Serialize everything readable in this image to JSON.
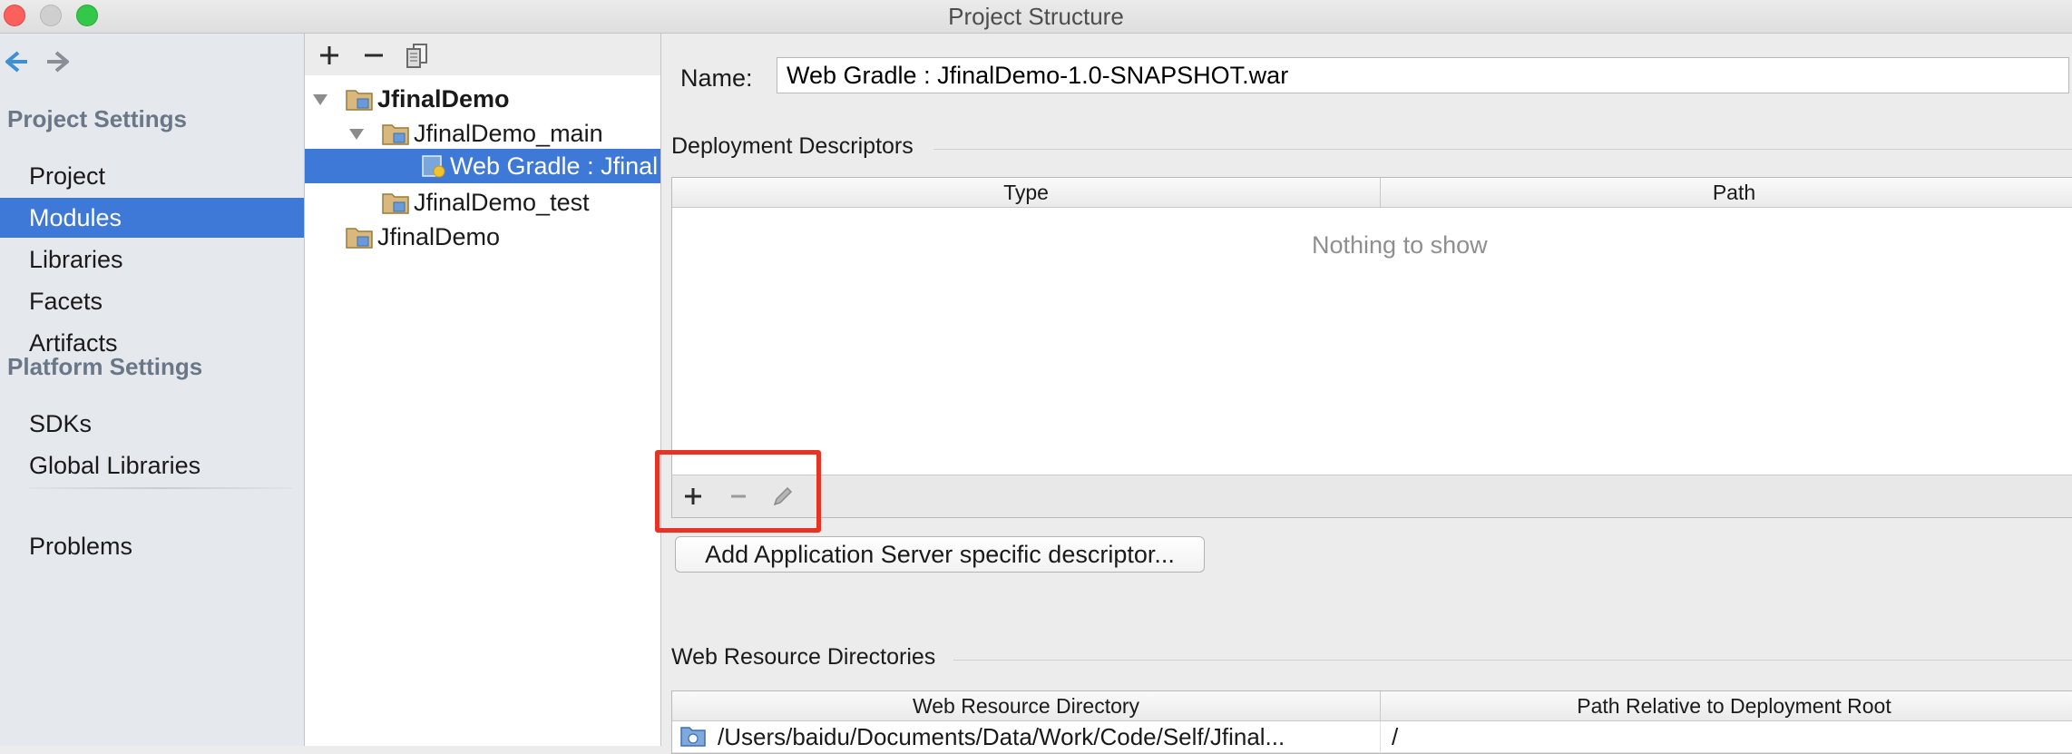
{
  "window": {
    "title": "Project Structure"
  },
  "nav": {
    "sections": [
      {
        "header": "Project Settings",
        "items": [
          "Project",
          "Modules",
          "Libraries",
          "Facets",
          "Artifacts"
        ]
      },
      {
        "header": "Platform Settings",
        "items": [
          "SDKs",
          "Global Libraries"
        ]
      }
    ],
    "problems": "Problems",
    "selected": "Modules"
  },
  "tree": {
    "nodes": [
      {
        "label": "JfinalDemo",
        "bold": true,
        "expanded": true
      },
      {
        "label": "JfinalDemo_main",
        "expanded": true
      },
      {
        "label": "Web Gradle : Jfinal",
        "selected": true
      },
      {
        "label": "JfinalDemo_test"
      },
      {
        "label": "JfinalDemo"
      }
    ]
  },
  "details": {
    "name_label": "Name:",
    "name_value": "Web Gradle : JfinalDemo-1.0-SNAPSHOT.war",
    "deployment": {
      "title": "Deployment Descriptors",
      "columns": [
        "Type",
        "Path"
      ],
      "empty_text": "Nothing to show",
      "toolbar": [
        "add-icon",
        "remove-icon",
        "edit-icon"
      ]
    },
    "add_server_button": "Add Application Server specific descriptor...",
    "web_resources": {
      "title": "Web Resource Directories",
      "columns": [
        "Web Resource Directory",
        "Path Relative to Deployment Root"
      ],
      "rows": [
        {
          "directory": "/Users/baidu/Documents/Data/Work/Code/Self/Jfinal...",
          "path": "/"
        }
      ]
    }
  },
  "colors": {
    "selection": "#3f79d7",
    "highlight_box": "#e83224",
    "nav_header": "#6a7787"
  }
}
